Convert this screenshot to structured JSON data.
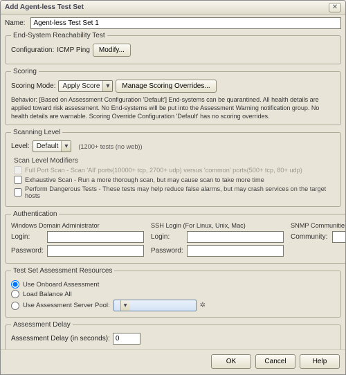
{
  "dialog": {
    "title": "Add Agent-less Test Set",
    "close_icon": "close-icon"
  },
  "name": {
    "label": "Name:",
    "value": "Agent-less Test Set 1"
  },
  "reachability": {
    "legend": "End-System Reachability Test",
    "config_label": "Configuration:",
    "config_value": "ICMP Ping",
    "modify_label": "Modify..."
  },
  "scoring": {
    "legend": "Scoring",
    "mode_label": "Scoring Mode:",
    "mode_value": "Apply Score",
    "manage_label": "Manage Scoring Overrides...",
    "behavior": "Behavior: [Based on Assessment Configuration 'Default'] End-systems can be quarantined. All health details are applied toward risk assessment. No End-systems will be put into the Assessment Warning notification group. No health details are warnable. Scoring Override Configuration 'Default' has no scoring overrides."
  },
  "scanning": {
    "legend": "Scanning Level",
    "level_label": "Level:",
    "level_value": "Default",
    "level_note": "(1200+ tests (no web))",
    "modifiers_title": "Scan Level Modifiers",
    "full_port_label": "Full Port Scan - Scan 'All' ports(10000+ tcp, 2700+ udp) versus 'common' ports(500+ tcp, 80+ udp)",
    "exhaustive_label": "Exhaustive Scan - Run a more thorough scan, but may cause scan to take more time",
    "dangerous_label": "Perform Dangerous Tests - These tests may help reduce false alarms, but may crash services on the target hosts"
  },
  "auth": {
    "legend": "Authentication",
    "win_header": "Windows Domain Administrator",
    "ssh_header": "SSH Login (For Linux, Unix, Mac)",
    "snmp_header": "SNMP Communities (comma delimited)",
    "login_label": "Login:",
    "password_label": "Password:",
    "community_label": "Community:",
    "win_login": "",
    "win_pass": "",
    "ssh_login": "",
    "ssh_pass": "",
    "community": ""
  },
  "resources": {
    "legend": "Test Set Assessment Resources",
    "onboard_label": "Use Onboard Assessment",
    "balance_label": "Load Balance All",
    "pool_label": "Use Assessment Server Pool:",
    "pool_value": ""
  },
  "delay": {
    "legend": "Assessment Delay",
    "label": "Assessment Delay (in seconds):",
    "value": "0"
  },
  "buttons": {
    "ok": "OK",
    "cancel": "Cancel",
    "help": "Help"
  }
}
